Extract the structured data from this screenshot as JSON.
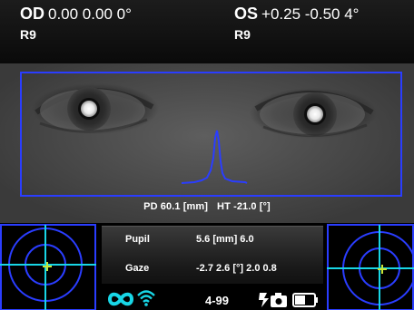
{
  "header": {
    "od": {
      "eye": "OD",
      "values": "0.00 0.00 0°",
      "sub": "R9"
    },
    "os": {
      "eye": "OS",
      "values": "+0.25 -0.50 4°",
      "sub": "R9"
    }
  },
  "image": {
    "pd_text": "PD 60.1 [mm]",
    "ht_text": "HT -21.0 [°]"
  },
  "measurements": {
    "pupil_label": "Pupil",
    "pupil_value": "5.6 [mm] 6.0",
    "gaze_label": "Gaze",
    "gaze_value": "-2.7  2.6 [°] 2.0  0.8"
  },
  "status": {
    "code_text": "4-99"
  },
  "colors": {
    "overlay_blue": "#2a3dff",
    "reticle_cyan": "#18d6e6",
    "target_green": "#c8e838"
  },
  "icons": [
    "infinity-icon",
    "wifi-icon",
    "camera-flash-icon",
    "battery-icon"
  ]
}
